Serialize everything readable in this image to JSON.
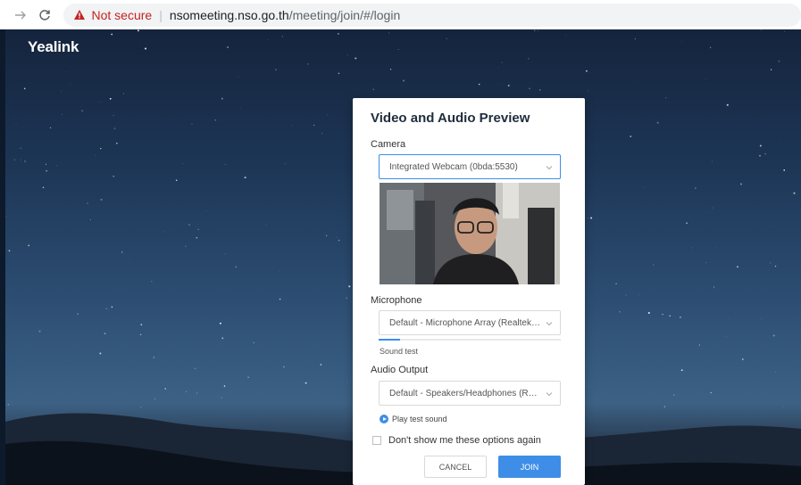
{
  "browser": {
    "not_secure": "Not secure",
    "separator": "|",
    "url_host": "nsomeeting.nso.go.th",
    "url_path": "/meeting/join/#/login",
    "icons": [
      "forward-arrow-icon",
      "reload-icon",
      "warning-triangle-icon"
    ]
  },
  "brand": {
    "logo_text": "Yealink"
  },
  "dialog": {
    "title": "Video and Audio Preview",
    "camera": {
      "label": "Camera",
      "selected": "Integrated Webcam (0bda:5530)"
    },
    "microphone": {
      "label": "Microphone",
      "selected": "Default - Microphone Array (Realtek(R...",
      "level": 0.12,
      "sound_test": "Sound test"
    },
    "audio_output": {
      "label": "Audio Output",
      "selected": "Default - Speakers/Headphones (Real...",
      "play_test": "Play test sound"
    },
    "dont_show": "Don't show me these options again",
    "cancel": "CANCEL",
    "join": "JOIN"
  },
  "colors": {
    "accent": "#3e8ee8",
    "warning": "#c5221f",
    "sky_top": "#15243d",
    "sky_horizon": "#3d6184"
  }
}
